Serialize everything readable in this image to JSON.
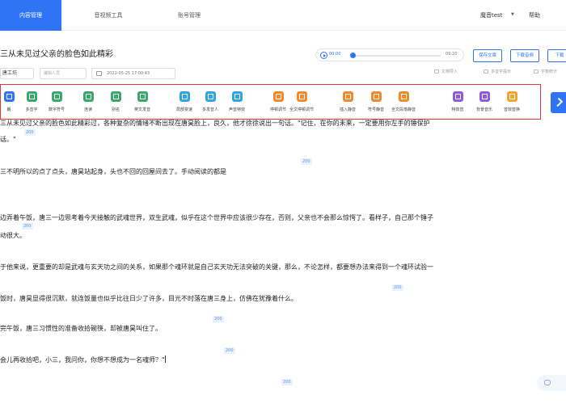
{
  "nav": {
    "tabs": [
      "内容管理",
      "音视频工具",
      "账号管理"
    ],
    "user": "魔音test",
    "help": "帮助"
  },
  "doc": {
    "title": "三从未见过父亲的脸色如此精彩",
    "reader": "唐工坊",
    "input_placeholder": "编辑人员",
    "datetime": "2021-05-25 17:00:43"
  },
  "player": {
    "current": "00:00",
    "total": "09:20",
    "progress": 0
  },
  "header_buttons": [
    "保存文章",
    "下载音频",
    "下载"
  ],
  "header_options": [
    "文档导入",
    "多音字提示",
    "字数统计"
  ],
  "toolbar": [
    {
      "label": "朗",
      "color": "#2f74f5",
      "icon": "play-circle-icon"
    },
    {
      "label": "多音字",
      "color": "#3aa86b",
      "icon": "polyphone-icon"
    },
    {
      "label": "数字符号",
      "color": "#3aa86b",
      "icon": "number-icon"
    },
    {
      "label": "连读",
      "color": "#3aa86b",
      "icon": "link-read-icon"
    },
    {
      "label": "别名",
      "color": "#3aa86b",
      "icon": "alias-icon"
    },
    {
      "label": "英文发音",
      "color": "#3aa86b",
      "icon": "english-icon"
    },
    {
      "label": "局部变速",
      "color": "#2fa6df",
      "icon": "speed-icon"
    },
    {
      "label": "多发音人",
      "color": "#2fa6df",
      "icon": "speakers-icon"
    },
    {
      "label": "声音特效",
      "color": "#2fa6df",
      "icon": "effect-icon"
    },
    {
      "label": "停顿调节",
      "color": "#f08c2e",
      "icon": "pause-adjust-icon"
    },
    {
      "label": "全文停顿调节",
      "color": "#f08c2e",
      "icon": "full-pause-icon"
    },
    {
      "label": "插入静音",
      "color": "#f08c2e",
      "icon": "insert-silence-icon"
    },
    {
      "label": "符号静音",
      "color": "#f08c2e",
      "icon": "symbol-silence-icon"
    },
    {
      "label": "全文段落静音",
      "color": "#f08c2e",
      "icon": "paragraph-silence-icon"
    },
    {
      "label": "特效音",
      "color": "#8e5ad6",
      "icon": "sound-effect-icon"
    },
    {
      "label": "背景音乐",
      "color": "#8e5ad6",
      "icon": "bgm-icon"
    },
    {
      "label": "音效替换",
      "color": "#f0a52e",
      "icon": "replace-icon"
    }
  ],
  "paragraphs": [
    {
      "text": "三从未见过父亲的脸色如此精彩过，各种复杂的情绪不断出现在唐昊脸上，良久，他才徐徐说出一句话。\"记住，在你的未来，一定要用你左手的锤保护",
      "badge": null
    },
    {
      "text": "话。\"",
      "badge": "200"
    },
    {
      "text": "三不明所以的点了点头，唐昊站起身，头也不回的回屋间去了。手动阅读的都是",
      "badge": "200"
    },
    {
      "text": "边弄着午饭，唐三一边思考着今天接触的武魂世界，双生武魂，似乎在这个世界中应该很少存在，否则，父亲也不会那么惊愕了。看样子，自己那个锤子",
      "badge": null
    },
    {
      "text": "动很大。",
      "badge": "200"
    },
    {
      "text": "于他来说，更重要的却是武魂与玄天功之间的关系，如果那个魂环就是自己玄天功无法突破的关键，那么，不论怎样，都要想办法来得到一个魂环试验一",
      "badge": null
    },
    {
      "text": "饭时，唐昊显得很沉默，就连饭量也似乎比往日少了许多，目光不时落在唐三身上，仿佛在犹豫着什么。",
      "badge": "200"
    },
    {
      "text": "完午饭，唐三习惯性的准备收拾碗筷，却被唐昊叫住了。",
      "badge": "200"
    },
    {
      "text": "会儿再收拾吧，小三，我问你，你想不想成为一名魂师？\"",
      "badge": "200"
    },
    {
      "text": "",
      "badge": "200"
    }
  ]
}
